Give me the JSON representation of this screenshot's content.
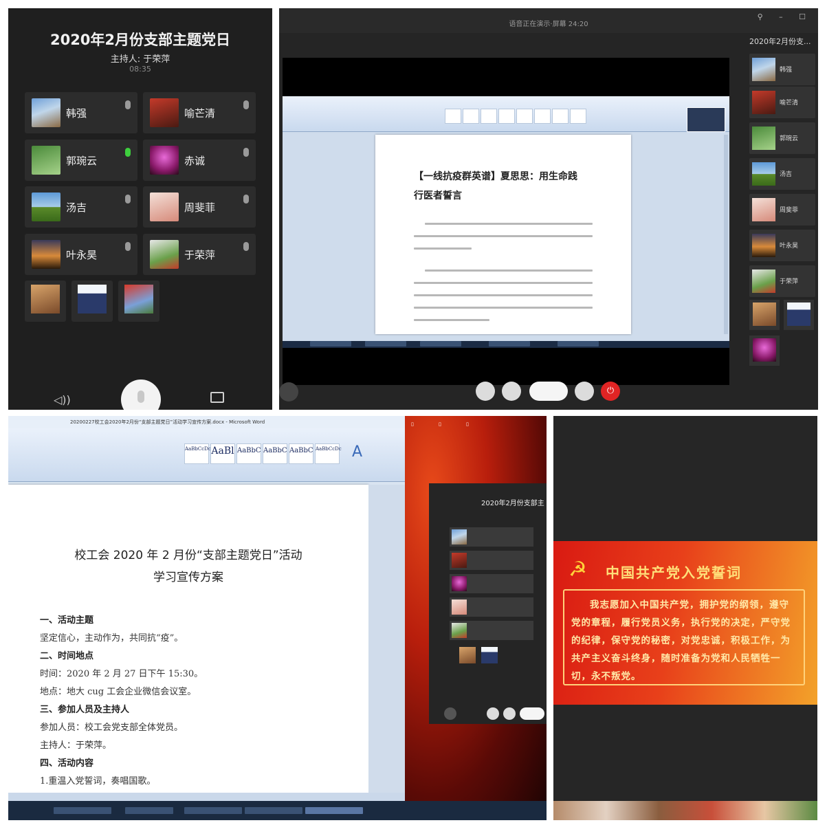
{
  "mobile": {
    "title": "2020年2月份支部主题党日",
    "host": "主持人: 于荣萍",
    "timer": "08:35",
    "participants": [
      {
        "name": "韩强",
        "mic": "muted"
      },
      {
        "name": "喻芒清",
        "mic": "muted"
      },
      {
        "name": "郭琬云",
        "mic": "speaking"
      },
      {
        "name": "赤诚",
        "mic": "muted"
      },
      {
        "name": "汤吉",
        "mic": "muted"
      },
      {
        "name": "周斐菲",
        "mic": "muted"
      },
      {
        "name": "叶永昊",
        "mic": "muted"
      },
      {
        "name": "于荣萍",
        "mic": "muted"
      }
    ],
    "extra_avatars": [
      "",
      "",
      ""
    ]
  },
  "desktop": {
    "status": "语音正在演示·屏幕 24:20",
    "side_title": "2020年2月份支...",
    "window_controls": "⚲ – ☐",
    "shared_doc": {
      "headline_1": "【一线抗疫群英谱】夏思思：用生命践",
      "headline_2": "行医者誓言"
    },
    "side_participants": [
      "韩强",
      "喻芒清",
      "郭琬云",
      "汤吉",
      "周斐菲",
      "叶永昊",
      "于荣萍"
    ],
    "bottom_avatar_caps": [
      "",
      "",
      ""
    ]
  },
  "word": {
    "window_title": "20200227校工会2020年2月份“支部主题党日”活动学习宣传方案.docx - Microsoft Word",
    "style_samples": [
      "AaBbCcDc",
      "AaBl",
      "AaBbC",
      "AaBbC",
      "AaBbC",
      "AaBbCcDc"
    ],
    "doc": {
      "title_1": "校工会 2020 年 2 月份“支部主题党日”活动",
      "title_2": "学习宣传方案",
      "lines": [
        {
          "text": "一、活动主题",
          "heading": true
        },
        {
          "text": "坚定信心，主动作为，共同抗“疫”。",
          "heading": false
        },
        {
          "text": "二、时间地点",
          "heading": true
        },
        {
          "text": "时间：2020 年 2 月 27 日下午 15:30。",
          "heading": false
        },
        {
          "text": "地点：地大 cug 工会企业微信会议室。",
          "heading": false
        },
        {
          "text": "三、参加人员及主持人",
          "heading": true
        },
        {
          "text": "参加人员：校工会党支部全体党员。",
          "heading": false
        },
        {
          "text": "主持人：于荣萍。",
          "heading": false
        },
        {
          "text": "四、活动内容",
          "heading": true
        },
        {
          "text": "1.重温入党誓词，奏唱国歌。",
          "heading": false
        }
      ]
    }
  },
  "mini_meeting": {
    "title": "2020年2月份支部主"
  },
  "pledge": {
    "heading": "中国共产党入党誓词",
    "text": "我志愿加入中国共产党，拥护党的纲领，遵守党的章程，履行党员义务，执行党的决定，严守党的纪律，保守党的秘密，对党忠诚，积极工作，为共产主义奋斗终身，随时准备为党和人民牺牲一切，永不叛党。"
  },
  "colors": {
    "dark_bg": "#1f1f1f",
    "speaking_mic": "#3ecf3e",
    "end_call": "#e02424",
    "banner_red": "#d91a12",
    "banner_gold": "#ffe07a"
  }
}
